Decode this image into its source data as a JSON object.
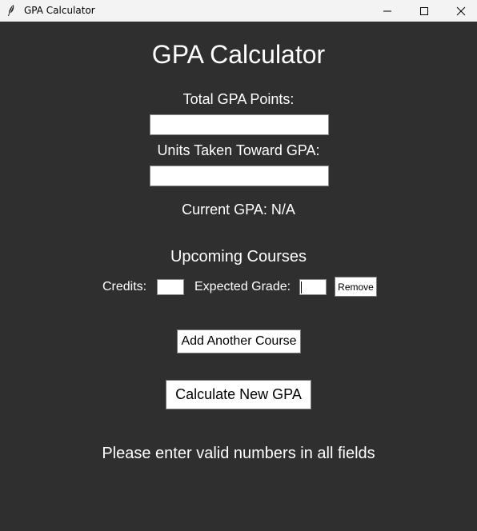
{
  "window": {
    "title": "GPA Calculator"
  },
  "main": {
    "heading": "GPA Calculator",
    "total_points_label": "Total GPA Points:",
    "total_points_value": "",
    "units_label": "Units Taken Toward GPA:",
    "units_value": "",
    "current_gpa": "Current GPA: N/A",
    "upcoming_heading": "Upcoming Courses",
    "course": {
      "credits_label": "Credits:",
      "credits_value": "",
      "grade_label": "Expected Grade:",
      "grade_value": "",
      "remove_label": "Remove"
    },
    "add_course_label": "Add Another Course",
    "calculate_label": "Calculate New GPA",
    "message": "Please enter valid numbers in all fields"
  },
  "colors": {
    "background": "#2f2f2f",
    "titlebar": "#f3f3f3",
    "text": "#ffffff"
  },
  "icons": [
    "feather-icon",
    "minimize-icon",
    "maximize-icon",
    "close-icon"
  ]
}
